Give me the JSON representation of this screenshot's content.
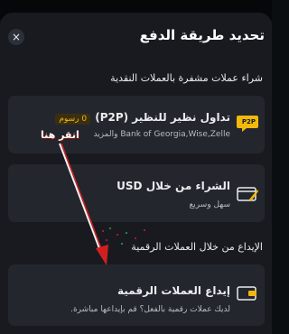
{
  "header": {
    "title": "تحديد طريقة الدفع",
    "close_label": "×"
  },
  "sections": {
    "crypto_purchase": "شراء عملات مشفرة بالعملات النقدية",
    "crypto_deposit": "الإيداع من خلال العملات الرقمية"
  },
  "cards": {
    "p2p": {
      "title": "تداول نظير للنظير (P2P)",
      "badge": "0 رسوم",
      "subtitle": "Bank of Georgia,Wise,Zelle والمزيد",
      "icon": "p2p-icon",
      "icon_label": "P2P"
    },
    "usd": {
      "title": "الشراء من خلال USD",
      "subtitle": "سهل وسريع",
      "icon": "card-rocket-icon"
    },
    "deposit": {
      "title": "إيداع العملات الرقمية",
      "subtitle": "لديك عملات رقمية بالفعل؟ قم بإيداعها مباشرة.",
      "icon": "wallet-icon"
    }
  },
  "annotation": {
    "label": "انقر هنا",
    "color": "#d11f1f"
  },
  "colors": {
    "accent": "#f0b90b",
    "sheet_background": "#181a20",
    "card_background": "#23262c"
  }
}
